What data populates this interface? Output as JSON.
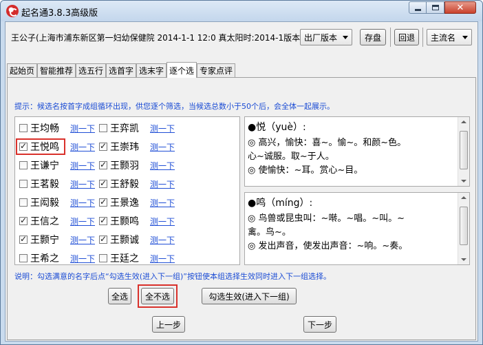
{
  "window": {
    "title": "起名通3.8.3高级版",
    "close_glyph": "✕"
  },
  "toolbar": {
    "info": "王公子(上海市浦东新区第一妇幼保健院 2014-1-1 12:0 真太阳时:2014-1版本:",
    "version_combo": "出厂版本",
    "save_label": "存盘",
    "back_label": "回退",
    "mode_combo": "主流名"
  },
  "tabs": [
    {
      "label": "起始页",
      "active": false
    },
    {
      "label": "智能推荐",
      "active": false
    },
    {
      "label": "选五行",
      "active": false
    },
    {
      "label": "选首字",
      "active": false
    },
    {
      "label": "选末字",
      "active": false
    },
    {
      "label": "逐个选",
      "active": true
    },
    {
      "label": "专家点评",
      "active": false
    }
  ],
  "hint": "提示：候选名按首字成组循环出现，供您逐个筛选，当候选总数小于50个后，会全体一起展示。",
  "names": {
    "test_label": "测一下",
    "left": [
      {
        "name": "王均畅",
        "checked": false
      },
      {
        "name": "王悦鸣",
        "checked": true
      },
      {
        "name": "王谦宁",
        "checked": false
      },
      {
        "name": "王茗毅",
        "checked": false
      },
      {
        "name": "王闳毅",
        "checked": false
      },
      {
        "name": "王信之",
        "checked": true
      },
      {
        "name": "王颢宁",
        "checked": true
      },
      {
        "name": "王希之",
        "checked": false
      }
    ],
    "right": [
      {
        "name": "王弈凯",
        "checked": false
      },
      {
        "name": "王崇玮",
        "checked": true
      },
      {
        "name": "王颢羽",
        "checked": true
      },
      {
        "name": "王舒毅",
        "checked": true
      },
      {
        "name": "王景逸",
        "checked": true
      },
      {
        "name": "王颢鸣",
        "checked": true
      },
      {
        "name": "王颢诚",
        "checked": true
      },
      {
        "name": "王廷之",
        "checked": false
      }
    ]
  },
  "dict1": {
    "head": "●悦（yuè）:",
    "lines": [
      "◎ 高兴，愉快：喜~。愉~。和颜~色。",
      "心~诚服。取~于人。",
      "◎ 使愉快：~耳。赏心~目。"
    ]
  },
  "dict2": {
    "head": "●鸣（míng）:",
    "lines": [
      "◎ 鸟兽或昆虫叫：~啭。~唱。~叫。~",
      "禽。鸟~。",
      "◎ 发出声音，使发出声音：~响。~奏。"
    ]
  },
  "explain": "说明：勾选满意的名字后点“勾选生效(进入下一组)”按钮使本组选择生效同时进入下一组选择。",
  "buttons": {
    "select_all": "全选",
    "select_none": "全不选",
    "apply": "勾选生效(进入下一组)",
    "prev": "上一步",
    "next": "下一步"
  },
  "highlight_color": "#d9302a",
  "link_color": "#1f4ed6",
  "hint_color": "#1a4bd4"
}
